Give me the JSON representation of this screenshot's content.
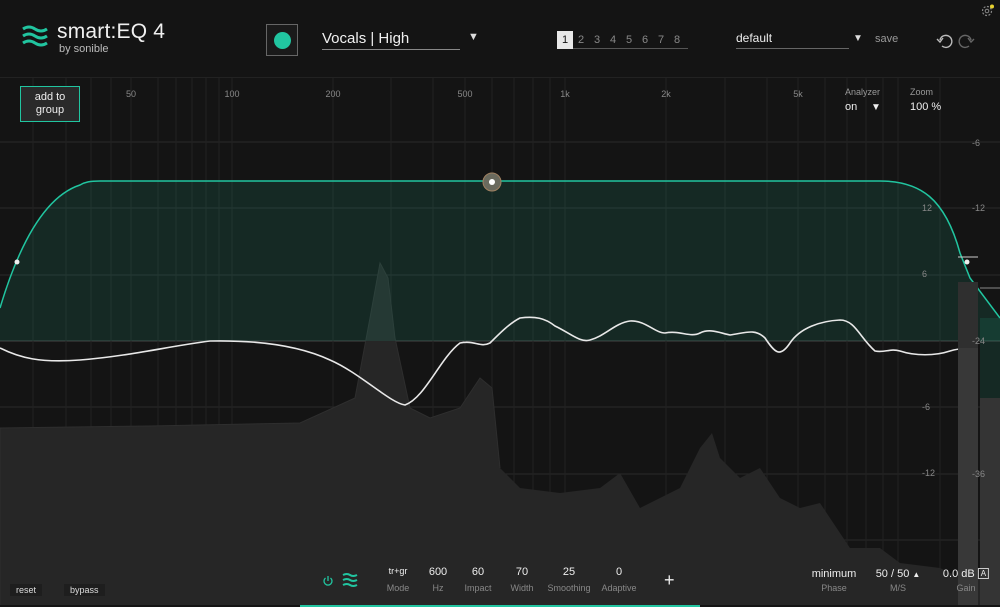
{
  "header": {
    "logo_title": "smart:EQ 4",
    "logo_by": "by sonible",
    "profile": "Vocals | High",
    "slots": [
      "1",
      "2",
      "3",
      "4",
      "5",
      "6",
      "7",
      "8"
    ],
    "active_slot": "1",
    "preset": "default",
    "save_label": "save",
    "accent": "#21c5a0"
  },
  "graph": {
    "add_group_line1": "add to",
    "add_group_line2": "group",
    "freq_labels": [
      "50",
      "100",
      "200",
      "500",
      "1k",
      "2k",
      "5k"
    ],
    "db_inner": [
      "12",
      "6",
      "-6",
      "-12"
    ],
    "db_outer": [
      "-6",
      "-12",
      "-24",
      "-36"
    ],
    "analyzer_label": "Analyzer",
    "analyzer_value": "on",
    "zoom_label": "Zoom",
    "zoom_value": "100 %"
  },
  "footer": {
    "reset_label": "reset",
    "bypass_label": "bypass",
    "mode": {
      "value": "tr+gr",
      "label": "Mode"
    },
    "hz": {
      "value": "600",
      "label": "Hz"
    },
    "impact": {
      "value": "60",
      "label": "Impact"
    },
    "width": {
      "value": "70",
      "label": "Width"
    },
    "smoothing": {
      "value": "25",
      "label": "Smoothing"
    },
    "adaptive": {
      "value": "0",
      "label": "Adaptive"
    },
    "phase": {
      "value": "minimum",
      "label": "Phase"
    },
    "ms": {
      "value": "50 / 50",
      "label": "M/S"
    },
    "gain": {
      "value": "0.0 dB",
      "label": "Gain",
      "badge": "A"
    }
  }
}
